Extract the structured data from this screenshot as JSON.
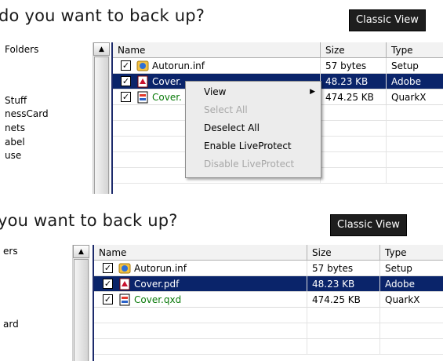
{
  "top_panel": {
    "heading": "do you want to back up?",
    "classic_view_label": "Classic View",
    "left_items": [
      "Folders",
      "Stuff",
      "nessCard",
      "nets",
      "abel",
      "use"
    ],
    "columns": [
      "Name",
      "Size",
      "Type"
    ],
    "rows": [
      {
        "name": "Autorun.inf",
        "size": "57 bytes",
        "type": "Setup",
        "checked": "✓",
        "state": "normal"
      },
      {
        "name": "Cover.",
        "size": "48.23 KB",
        "type": "Adobe",
        "checked": "✓",
        "state": "selected"
      },
      {
        "name": "Cover.",
        "size": "474.25 KB",
        "type": "QuarkX",
        "checked": "✓",
        "state": "green"
      }
    ],
    "context_menu": {
      "items": [
        {
          "label": "View",
          "disabled": false,
          "submenu_arrow": "▶"
        },
        {
          "label": "Select All",
          "disabled": true,
          "submenu_arrow": ""
        },
        {
          "label": "Deselect All",
          "disabled": false,
          "submenu_arrow": ""
        },
        {
          "label": "Enable LiveProtect",
          "disabled": false,
          "submenu_arrow": ""
        },
        {
          "label": "Disable LiveProtect",
          "disabled": true,
          "submenu_arrow": ""
        }
      ]
    }
  },
  "bottom_panel": {
    "heading": "you want to back up?",
    "classic_view_label": "Classic View",
    "left_items": [
      "ers",
      "ard"
    ],
    "columns": [
      "Name",
      "Size",
      "Type"
    ],
    "rows": [
      {
        "name": "Autorun.inf",
        "size": "57 bytes",
        "type": "Setup",
        "checked": "✓",
        "state": "normal"
      },
      {
        "name": "Cover.pdf",
        "size": "48.23 KB",
        "type": "Adobe",
        "checked": "✓",
        "state": "selected"
      },
      {
        "name": "Cover.qxd",
        "size": "474.25 KB",
        "type": "QuarkX",
        "checked": "✓",
        "state": "green"
      }
    ]
  },
  "icons": {
    "scroll_up": "▲"
  },
  "colors": {
    "selection": "#0a246a",
    "green_text": "#0a7a0a",
    "button_bg": "#1e1e1e"
  }
}
